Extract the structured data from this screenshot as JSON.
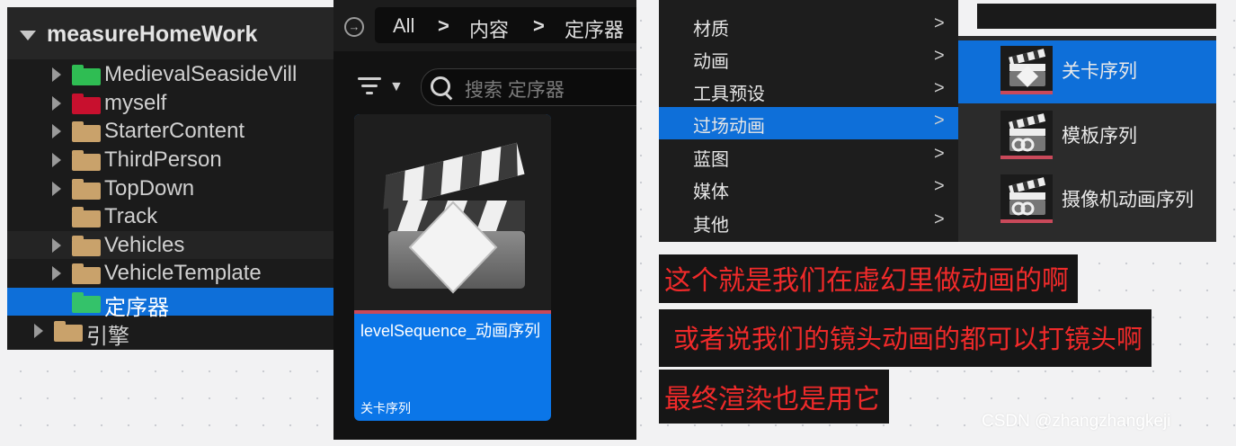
{
  "tree": {
    "root_label": "measureHomeWork",
    "items": [
      {
        "label": "MedievalSeasideVill",
        "color": "#2fbd53"
      },
      {
        "label": "myself",
        "color": "#c8102e"
      },
      {
        "label": "StarterContent",
        "color": "#c9a26b"
      },
      {
        "label": "ThirdPerson",
        "color": "#c9a26b"
      },
      {
        "label": "TopDown",
        "color": "#c9a26b"
      },
      {
        "label": "Track",
        "color": "#c9a26b"
      },
      {
        "label": "Vehicles",
        "color": "#c9a26b"
      },
      {
        "label": "VehicleTemplate",
        "color": "#c9a26b"
      },
      {
        "label": "定序器",
        "color": "#34c26a"
      },
      {
        "label": "引擎",
        "color": "#c9a26b"
      }
    ]
  },
  "browser": {
    "breadcrumb": [
      "All",
      "内容",
      "定序器"
    ],
    "breadcrumb_separator": ">",
    "search_placeholder": "搜索 定序器",
    "asset": {
      "name": "levelSequence_动画序列",
      "type": "关卡序列"
    }
  },
  "menu": {
    "items": [
      {
        "label": "材质",
        "arrow": ">"
      },
      {
        "label": "动画",
        "arrow": ">"
      },
      {
        "label": "工具预设",
        "arrow": ">"
      },
      {
        "label": "过场动画",
        "arrow": ">"
      },
      {
        "label": "蓝图",
        "arrow": ">"
      },
      {
        "label": "媒体",
        "arrow": ">"
      },
      {
        "label": "其他",
        "arrow": ">"
      }
    ],
    "sub_items": [
      {
        "label": "关卡序列"
      },
      {
        "label": "模板序列"
      },
      {
        "label": "摄像机动画序列"
      }
    ]
  },
  "captions": [
    "这个就是我们在虚幻里做动画的啊",
    "或者说我们的镜头动画的都可以打镜头啊",
    "最终渲染也是用它"
  ],
  "watermark": "CSDN @zhangzhangkeji",
  "colors": {
    "selection_blue": "#0e6fd9",
    "tile_blue": "#0b76e8",
    "caption_red": "#f02a2a",
    "accent_pink": "#c9495a"
  }
}
